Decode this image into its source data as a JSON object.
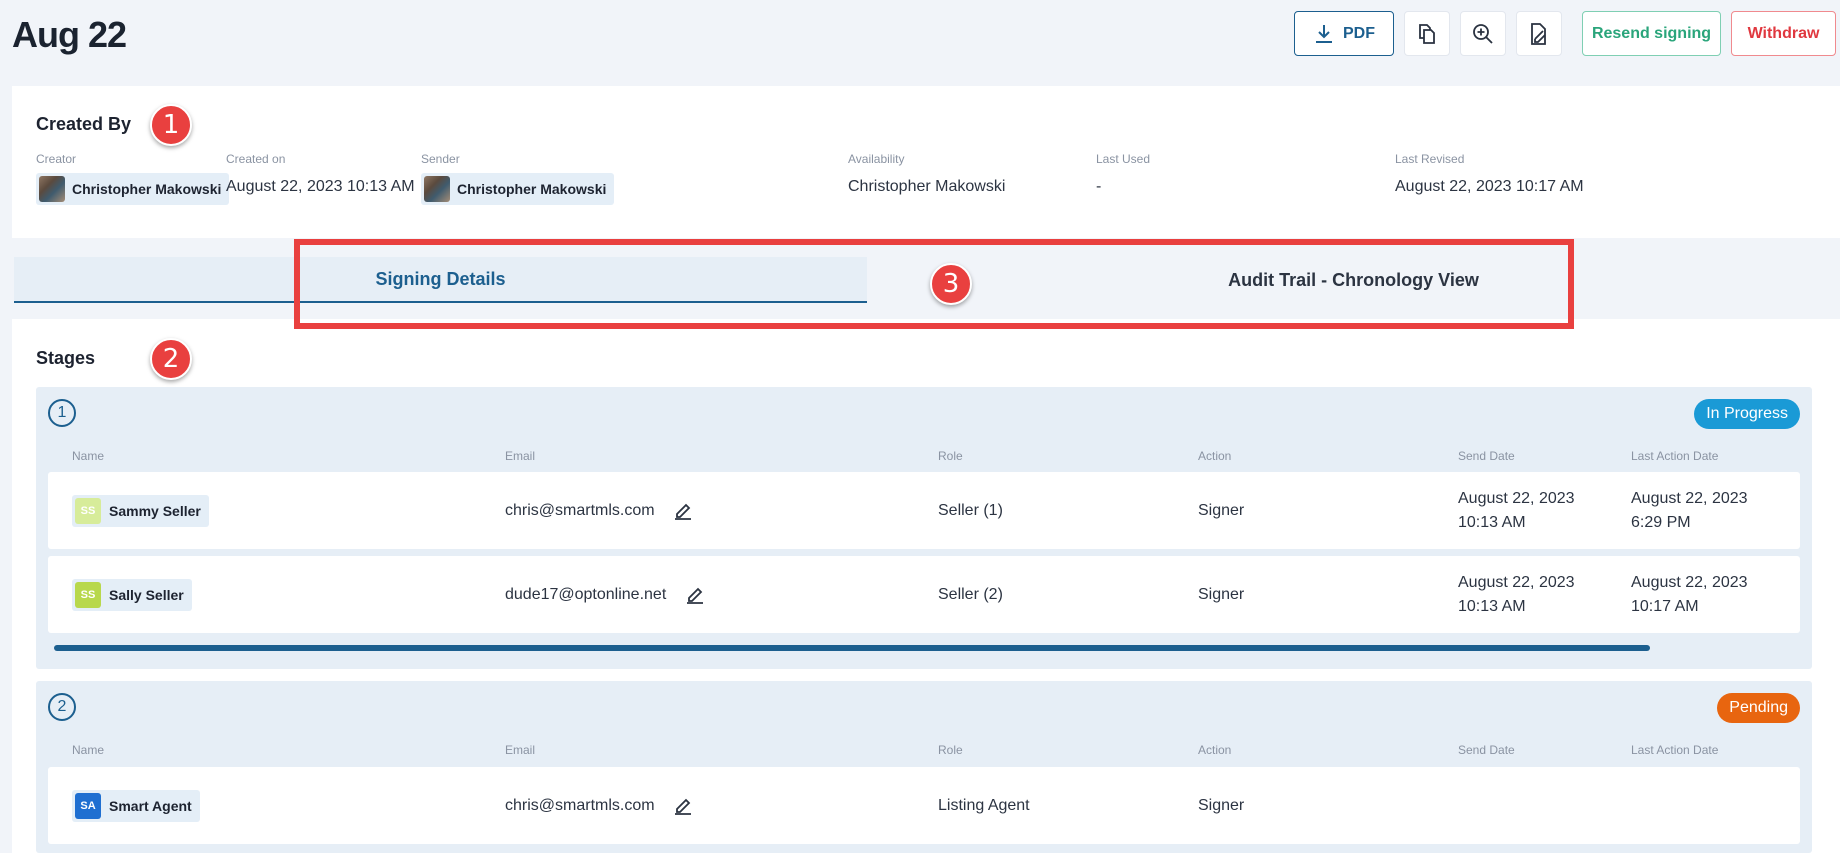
{
  "page": {
    "title": "Aug 22"
  },
  "toolbar": {
    "pdf_label": "PDF",
    "resend_label": "Resend signing",
    "withdraw_label": "Withdraw"
  },
  "created_by": {
    "title": "Created By",
    "creator_label": "Creator",
    "creator_name": "Christopher Makowski",
    "created_on_label": "Created on",
    "created_on_value": "August 22, 2023 10:13 AM",
    "sender_label": "Sender",
    "sender_name": "Christopher Makowski",
    "availability_label": "Availability",
    "availability_value": "Christopher Makowski",
    "last_used_label": "Last Used",
    "last_used_value": "-",
    "last_revised_label": "Last Revised",
    "last_revised_value": "August 22, 2023 10:17 AM"
  },
  "callouts": [
    "1",
    "2",
    "3"
  ],
  "tabs": [
    {
      "label": "Signing Details",
      "active": true
    },
    {
      "label": "Audit Trail - Chronology View",
      "active": false
    }
  ],
  "stages": {
    "title": "Stages",
    "columns": [
      "Name",
      "Email",
      "Role",
      "Action",
      "Send Date",
      "Last Action Date"
    ],
    "items": [
      {
        "number": "1",
        "status": "In Progress",
        "status_color": "#1a9ad6",
        "rows": [
          {
            "initials": "SS",
            "initials_bg": "#d7ec9a",
            "initials_color": "#ffffff",
            "name": "Sammy Seller",
            "email": "chris@smartmls.com",
            "role": "Seller (1)",
            "action": "Signer",
            "send_date_line1": "August 22, 2023",
            "send_date_line2": "10:13 AM",
            "last_action_line1": "August 22, 2023",
            "last_action_line2": "6:29 PM"
          },
          {
            "initials": "SS",
            "initials_bg": "#b8d84c",
            "initials_color": "#ffffff",
            "name": "Sally Seller",
            "email": "dude17@optonline.net",
            "role": "Seller (2)",
            "action": "Signer",
            "send_date_line1": "August 22, 2023",
            "send_date_line2": "10:13 AM",
            "last_action_line1": "August 22, 2023",
            "last_action_line2": "10:17 AM"
          }
        ]
      },
      {
        "number": "2",
        "status": "Pending",
        "status_color": "#e8650f",
        "rows": [
          {
            "initials": "SA",
            "initials_bg": "#1f6fd1",
            "initials_color": "#ffffff",
            "name": "Smart Agent",
            "email": "chris@smartmls.com",
            "role": "Listing Agent",
            "action": "Signer",
            "send_date_line1": "",
            "send_date_line2": "",
            "last_action_line1": "",
            "last_action_line2": ""
          }
        ]
      }
    ]
  },
  "colors": {
    "primary": "#1c5f8f",
    "success": "#2aa57b",
    "danger": "#e0383f",
    "callout": "#e9403f"
  },
  "icons": {
    "pdf": "download-icon",
    "copy": "copy-document-icon",
    "zoom": "zoom-in-icon",
    "doc_sign": "document-edit-icon",
    "edit": "pencil-icon"
  }
}
